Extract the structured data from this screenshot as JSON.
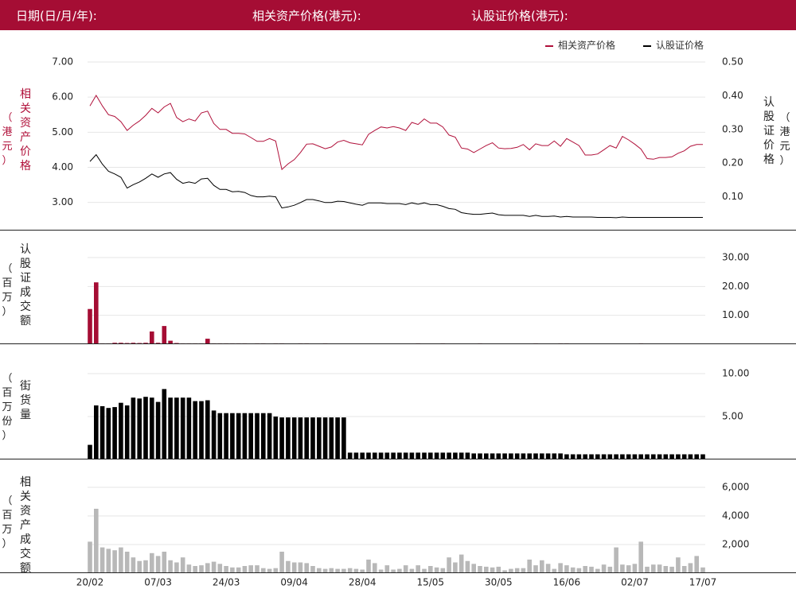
{
  "header": {
    "date_label": "日期(日/月/年):",
    "asset_price_label": "相关资产价格(港元):",
    "warrant_price_label": "认股证价格(港元):"
  },
  "legend": {
    "asset": "相关资产价格",
    "warrant": "认股证价格"
  },
  "axis_labels": {
    "asset_price": "相关资产价格",
    "asset_price_unit": "港元",
    "warrant_price": "认股证价格",
    "warrant_price_unit": "港元",
    "warrant_turnover": "认股证成交额",
    "warrant_turnover_unit": "百万",
    "outstanding": "街货量",
    "outstanding_unit": "百万份",
    "asset_turnover": "相关资产成交额",
    "asset_turnover_unit": "百万"
  },
  "colors": {
    "brand": "#a50d34",
    "asset_line": "#b0103a",
    "warrant_line": "#000000",
    "warrant_turnover_bar": "#a50d34",
    "outstanding_bar": "#000000",
    "asset_turnover_bar": "#b8b8b8"
  },
  "chart_data": [
    {
      "type": "line",
      "title": "",
      "x_ticks": [
        "20/02",
        "07/03",
        "24/03",
        "09/04",
        "28/04",
        "15/05",
        "30/05",
        "16/06",
        "02/07",
        "17/07"
      ],
      "y_left": {
        "label": "相关资产价格",
        "ticks": [
          "3.00",
          "4.00",
          "5.00",
          "6.00",
          "7.00"
        ],
        "ylim": [
          2.2,
          7.0
        ]
      },
      "y_right": {
        "label": "认股证价格",
        "ticks": [
          "0.10",
          "0.20",
          "0.30",
          "0.40",
          "0.50"
        ],
        "ylim": [
          0.0,
          0.5
        ]
      },
      "series": [
        {
          "name": "相关资产价格",
          "axis": "left",
          "values": [
            5.75,
            6.05,
            5.75,
            5.5,
            5.45,
            5.3,
            5.05,
            5.2,
            5.32,
            5.48,
            5.68,
            5.55,
            5.72,
            5.82,
            5.42,
            5.3,
            5.38,
            5.32,
            5.55,
            5.6,
            5.25,
            5.08,
            5.08,
            4.97,
            4.97,
            4.95,
            4.85,
            4.74,
            4.74,
            4.82,
            4.75,
            3.94,
            4.1,
            4.22,
            4.42,
            4.66,
            4.67,
            4.6,
            4.53,
            4.58,
            4.72,
            4.77,
            4.7,
            4.67,
            4.64,
            4.94,
            5.05,
            5.15,
            5.12,
            5.16,
            5.12,
            5.05,
            5.28,
            5.22,
            5.38,
            5.26,
            5.26,
            5.15,
            4.92,
            4.86,
            4.55,
            4.52,
            4.42,
            4.52,
            4.62,
            4.7,
            4.55,
            4.53,
            4.54,
            4.57,
            4.65,
            4.5,
            4.67,
            4.62,
            4.62,
            4.75,
            4.6,
            4.82,
            4.72,
            4.62,
            4.35,
            4.35,
            4.38,
            4.5,
            4.62,
            4.55,
            4.88,
            4.78,
            4.66,
            4.52,
            4.25,
            4.23,
            4.28,
            4.28,
            4.3,
            4.4,
            4.47,
            4.6,
            4.65,
            4.65
          ]
        },
        {
          "name": "认股证价格",
          "axis": "right",
          "values": [
            0.205,
            0.225,
            0.197,
            0.176,
            0.168,
            0.158,
            0.126,
            0.136,
            0.144,
            0.155,
            0.168,
            0.158,
            0.168,
            0.172,
            0.152,
            0.14,
            0.144,
            0.14,
            0.153,
            0.155,
            0.134,
            0.122,
            0.122,
            0.115,
            0.116,
            0.113,
            0.104,
            0.1,
            0.1,
            0.102,
            0.1,
            0.067,
            0.07,
            0.075,
            0.083,
            0.092,
            0.092,
            0.088,
            0.083,
            0.083,
            0.087,
            0.086,
            0.082,
            0.078,
            0.075,
            0.082,
            0.082,
            0.082,
            0.08,
            0.08,
            0.08,
            0.077,
            0.082,
            0.078,
            0.082,
            0.077,
            0.077,
            0.072,
            0.065,
            0.063,
            0.053,
            0.05,
            0.048,
            0.048,
            0.05,
            0.052,
            0.047,
            0.045,
            0.045,
            0.045,
            0.045,
            0.042,
            0.045,
            0.042,
            0.042,
            0.043,
            0.04,
            0.042,
            0.04,
            0.04,
            0.04,
            0.04,
            0.039,
            0.039,
            0.039,
            0.038,
            0.04,
            0.039,
            0.039,
            0.039,
            0.039,
            0.039,
            0.039,
            0.039,
            0.039,
            0.039,
            0.039,
            0.039,
            0.039,
            0.039
          ]
        }
      ],
      "legend_position": "top-right",
      "grid": true
    },
    {
      "type": "bar",
      "title": "",
      "ylabel": "认股证成交额（百万）",
      "y_ticks": [
        "10.00",
        "20.00",
        "30.00"
      ],
      "ylim": [
        0,
        30
      ],
      "x_ticks": [
        "20/02",
        "07/03",
        "24/03",
        "09/04",
        "28/04",
        "15/05",
        "30/05",
        "16/06",
        "02/07",
        "17/07"
      ],
      "values": [
        12.2,
        21.4,
        0.3,
        0.3,
        0.5,
        0.5,
        0.4,
        0.5,
        0.4,
        0.5,
        4.4,
        0.5,
        6.3,
        1.2,
        0.4,
        0.3,
        0.3,
        0.3,
        0.3,
        1.9,
        0.3,
        0.3,
        0.3,
        0.3,
        0.3,
        0.3,
        0,
        0.3,
        0.3,
        0,
        0.3,
        0.3,
        0,
        0,
        0.3,
        0.3,
        0,
        0,
        0.3,
        0,
        0,
        0,
        0,
        0,
        0,
        0,
        0,
        0,
        0,
        0,
        0,
        0,
        0,
        0.3,
        0,
        0,
        0,
        0.3,
        0,
        0,
        0,
        0,
        0,
        0.3,
        0,
        0,
        0,
        0,
        0,
        0,
        0,
        0,
        0.3,
        0,
        0,
        0,
        0.3,
        0.3,
        0,
        0,
        0,
        0,
        0,
        0,
        0,
        0,
        0,
        0,
        0,
        0.3,
        0,
        0,
        0,
        0,
        0,
        0,
        0,
        0,
        0,
        0
      ]
    },
    {
      "type": "bar",
      "title": "",
      "ylabel": "街货量（百万份）",
      "y_ticks": [
        "5.00",
        "10.00"
      ],
      "ylim": [
        0,
        10
      ],
      "x_ticks": [
        "20/02",
        "07/03",
        "24/03",
        "09/04",
        "28/04",
        "15/05",
        "30/05",
        "16/06",
        "02/07",
        "17/07"
      ],
      "values": [
        1.7,
        6.3,
        6.2,
        6.0,
        6.1,
        6.6,
        6.3,
        7.2,
        7.1,
        7.3,
        7.2,
        6.7,
        8.2,
        7.2,
        7.2,
        7.2,
        7.2,
        6.8,
        6.8,
        6.9,
        5.7,
        5.4,
        5.4,
        5.4,
        5.4,
        5.4,
        5.4,
        5.4,
        5.4,
        5.4,
        5.0,
        4.9,
        4.9,
        4.9,
        4.9,
        4.9,
        4.9,
        4.9,
        4.9,
        4.9,
        4.9,
        4.9,
        0.8,
        0.8,
        0.8,
        0.8,
        0.8,
        0.8,
        0.8,
        0.8,
        0.8,
        0.8,
        0.8,
        0.8,
        0.8,
        0.8,
        0.8,
        0.8,
        0.8,
        0.8,
        0.8,
        0.8,
        0.7,
        0.7,
        0.7,
        0.7,
        0.7,
        0.7,
        0.7,
        0.7,
        0.7,
        0.7,
        0.7,
        0.7,
        0.7,
        0.7,
        0.7,
        0.6,
        0.6,
        0.6,
        0.6,
        0.6,
        0.6,
        0.6,
        0.6,
        0.6,
        0.6,
        0.6,
        0.6,
        0.6,
        0.6,
        0.6,
        0.6,
        0.6,
        0.6,
        0.6,
        0.6,
        0.6,
        0.6,
        0.6
      ]
    },
    {
      "type": "bar",
      "title": "",
      "ylabel": "相关资产成交额（百万）",
      "y_ticks": [
        "2,000",
        "4,000",
        "6,000"
      ],
      "ylim": [
        0,
        6000
      ],
      "x_ticks": [
        "20/02",
        "07/03",
        "24/03",
        "09/04",
        "28/04",
        "15/05",
        "30/05",
        "16/06",
        "02/07",
        "17/07"
      ],
      "values": [
        2200,
        4500,
        1800,
        1700,
        1600,
        1800,
        1500,
        1100,
        850,
        900,
        1400,
        1200,
        1500,
        900,
        750,
        1100,
        600,
        500,
        550,
        700,
        800,
        650,
        500,
        400,
        400,
        500,
        550,
        550,
        350,
        300,
        350,
        1500,
        850,
        750,
        750,
        700,
        500,
        350,
        300,
        350,
        300,
        300,
        350,
        300,
        250,
        950,
        700,
        250,
        550,
        250,
        300,
        550,
        300,
        550,
        300,
        500,
        400,
        350,
        1100,
        750,
        1300,
        850,
        650,
        500,
        450,
        400,
        450,
        200,
        300,
        350,
        350,
        950,
        550,
        900,
        650,
        300,
        700,
        550,
        400,
        350,
        500,
        450,
        300,
        600,
        450,
        1800,
        600,
        550,
        650,
        2200,
        450,
        600,
        600,
        500,
        450,
        1100,
        500,
        700,
        1200,
        400
      ]
    }
  ]
}
